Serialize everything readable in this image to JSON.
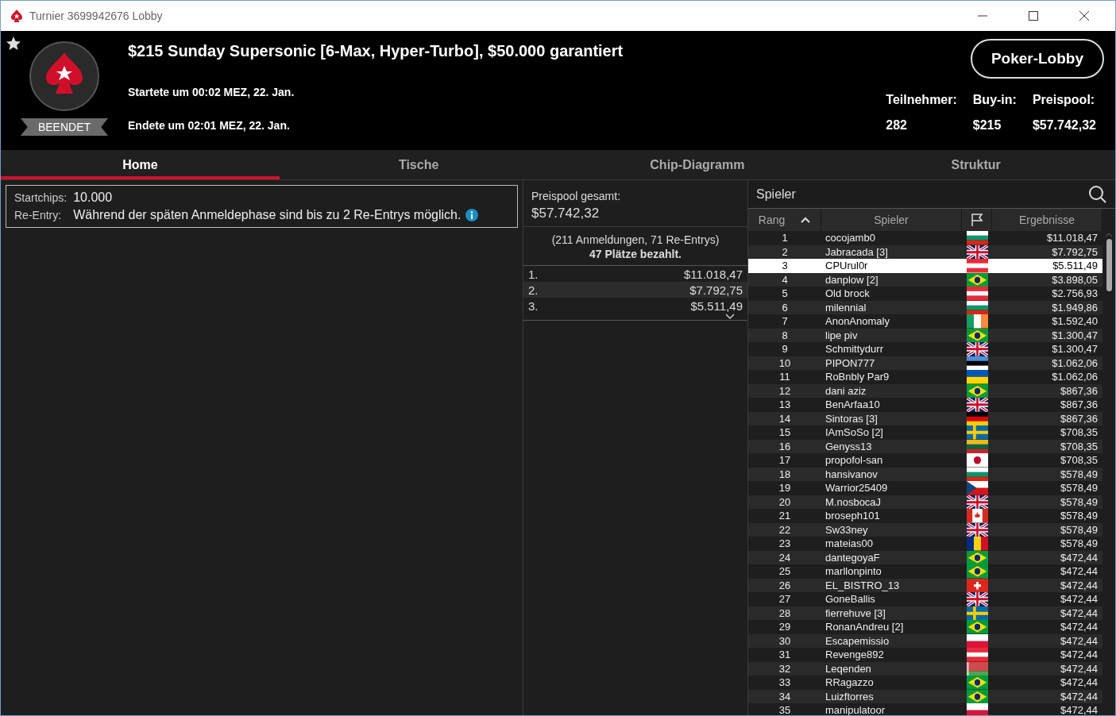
{
  "window": {
    "title": "Turnier 3699942676 Lobby"
  },
  "header": {
    "status": "BEENDET",
    "title": "$215 Sunday Supersonic [6-Max, Hyper-Turbo], $50.000 garantiert",
    "started": "Startete um 00:02 MEZ, 22. Jan.",
    "ended": "Endete um 02:01 MEZ, 22. Jan.",
    "button": "Poker-Lobby",
    "stats": [
      {
        "label": "Teilnehmer:",
        "value": "282"
      },
      {
        "label": "Buy-in:",
        "value": "$215"
      },
      {
        "label": "Preispool:",
        "value": "$57.742,32"
      }
    ]
  },
  "tabs": [
    {
      "label": "Home",
      "selected": true
    },
    {
      "label": "Tische",
      "selected": false
    },
    {
      "label": "Chip-Diagramm",
      "selected": false
    },
    {
      "label": "Struktur",
      "selected": false
    }
  ],
  "info": [
    {
      "label": "Startchips:",
      "value": "10.000",
      "info": false
    },
    {
      "label": "Re-Entry:",
      "value": "Während der späten Anmeldephase sind bis zu 2 Re-Entrys möglich.",
      "info": true
    }
  ],
  "prizepool": {
    "label": "Preispool gesamt:",
    "total": "$57.742,32",
    "entries": "(211 Anmeldungen, 71 Re-Entrys)",
    "paid": "47 Plätze bezahlt.",
    "places": [
      {
        "place": "1.",
        "amount": "$11.018,47"
      },
      {
        "place": "2.",
        "amount": "$7.792,75"
      },
      {
        "place": "3.",
        "amount": "$5.511,49"
      }
    ]
  },
  "players": {
    "search_label": "Spieler",
    "columns": [
      "Rang",
      "Spieler",
      "Ergebnisse"
    ],
    "rows": [
      {
        "rank": "1",
        "name": "cocojamb0",
        "kind": "bg",
        "result": "$11.018,47",
        "selected": false
      },
      {
        "rank": "2",
        "name": "Jabracada [3]",
        "kind": "gb",
        "result": "$7.792,75",
        "selected": false
      },
      {
        "rank": "3",
        "name": "CPUrul0r",
        "kind": "at",
        "result": "$5.511,49",
        "selected": true
      },
      {
        "rank": "4",
        "name": "danplow [2]",
        "kind": "br",
        "result": "$3.898,05",
        "selected": false
      },
      {
        "rank": "5",
        "name": "Old brock",
        "kind": "at",
        "result": "$2.756,93",
        "selected": false
      },
      {
        "rank": "6",
        "name": "milennial",
        "kind": "bg",
        "result": "$1.949,86",
        "selected": false
      },
      {
        "rank": "7",
        "name": "AnonAnomaly",
        "kind": "ie",
        "result": "$1.592,40",
        "selected": false
      },
      {
        "rank": "8",
        "name": "lipe piv",
        "kind": "br",
        "result": "$1.300,47",
        "selected": false
      },
      {
        "rank": "9",
        "name": "Schmittydurr",
        "kind": "gb",
        "result": "$1.300,47",
        "selected": false
      },
      {
        "rank": "10",
        "name": "PIPON777",
        "kind": "ee",
        "result": "$1.062,06",
        "selected": false
      },
      {
        "rank": "11",
        "name": "RoBnbly Par9",
        "kind": "ua",
        "result": "$1.062,06",
        "selected": false
      },
      {
        "rank": "12",
        "name": "dani aziz",
        "kind": "br",
        "result": "$867,36",
        "selected": false
      },
      {
        "rank": "13",
        "name": "BenArfaa10",
        "kind": "gb",
        "result": "$867,36",
        "selected": false
      },
      {
        "rank": "14",
        "name": "Sintoras [3]",
        "kind": "de",
        "result": "$867,36",
        "selected": false
      },
      {
        "rank": "15",
        "name": "IAmSoSo [2]",
        "kind": "se",
        "result": "$708,35",
        "selected": false
      },
      {
        "rank": "16",
        "name": "Genyss13",
        "kind": "lt",
        "result": "$708,35",
        "selected": false
      },
      {
        "rank": "17",
        "name": "propofol-san",
        "kind": "jp",
        "result": "$708,35",
        "selected": false
      },
      {
        "rank": "18",
        "name": "hansivanov",
        "kind": "bg",
        "result": "$578,49",
        "selected": false
      },
      {
        "rank": "19",
        "name": "Warrior25409",
        "kind": "cz",
        "result": "$578,49",
        "selected": false
      },
      {
        "rank": "20",
        "name": "M.nosbocaJ",
        "kind": "gb",
        "result": "$578,49",
        "selected": false
      },
      {
        "rank": "21",
        "name": "broseph101",
        "kind": "ca",
        "result": "$578,49",
        "selected": false
      },
      {
        "rank": "22",
        "name": "Sw33ney",
        "kind": "gb",
        "result": "$578,49",
        "selected": false
      },
      {
        "rank": "23",
        "name": "mateias00",
        "kind": "ro",
        "result": "$578,49",
        "selected": false
      },
      {
        "rank": "24",
        "name": "dantegoyaF",
        "kind": "br",
        "result": "$472,44",
        "selected": false
      },
      {
        "rank": "25",
        "name": "marllonpinto",
        "kind": "br",
        "result": "$472,44",
        "selected": false
      },
      {
        "rank": "26",
        "name": "EL_BISTRO_13",
        "kind": "ch",
        "result": "$472,44",
        "selected": false
      },
      {
        "rank": "27",
        "name": "GoneBallis",
        "kind": "gb",
        "result": "$472,44",
        "selected": false
      },
      {
        "rank": "28",
        "name": "fierrehuve [3]",
        "kind": "se",
        "result": "$472,44",
        "selected": false
      },
      {
        "rank": "29",
        "name": "RonanAndreu [2]",
        "kind": "br",
        "result": "$472,44",
        "selected": false
      },
      {
        "rank": "30",
        "name": "Escapemissio",
        "kind": "pl",
        "result": "$472,44",
        "selected": false
      },
      {
        "rank": "31",
        "name": "Revenge892",
        "kind": "at",
        "result": "$472,44",
        "selected": false
      },
      {
        "rank": "32",
        "name": "Leqenden",
        "kind": "by",
        "result": "$472,44",
        "selected": false
      },
      {
        "rank": "33",
        "name": "RRagazzo",
        "kind": "br",
        "result": "$472,44",
        "selected": false
      },
      {
        "rank": "34",
        "name": "Luizftorres",
        "kind": "br",
        "result": "$472,44",
        "selected": false
      },
      {
        "rank": "35",
        "name": "manipulatoor",
        "kind": "pl",
        "result": "$472,44",
        "selected": false
      }
    ]
  }
}
